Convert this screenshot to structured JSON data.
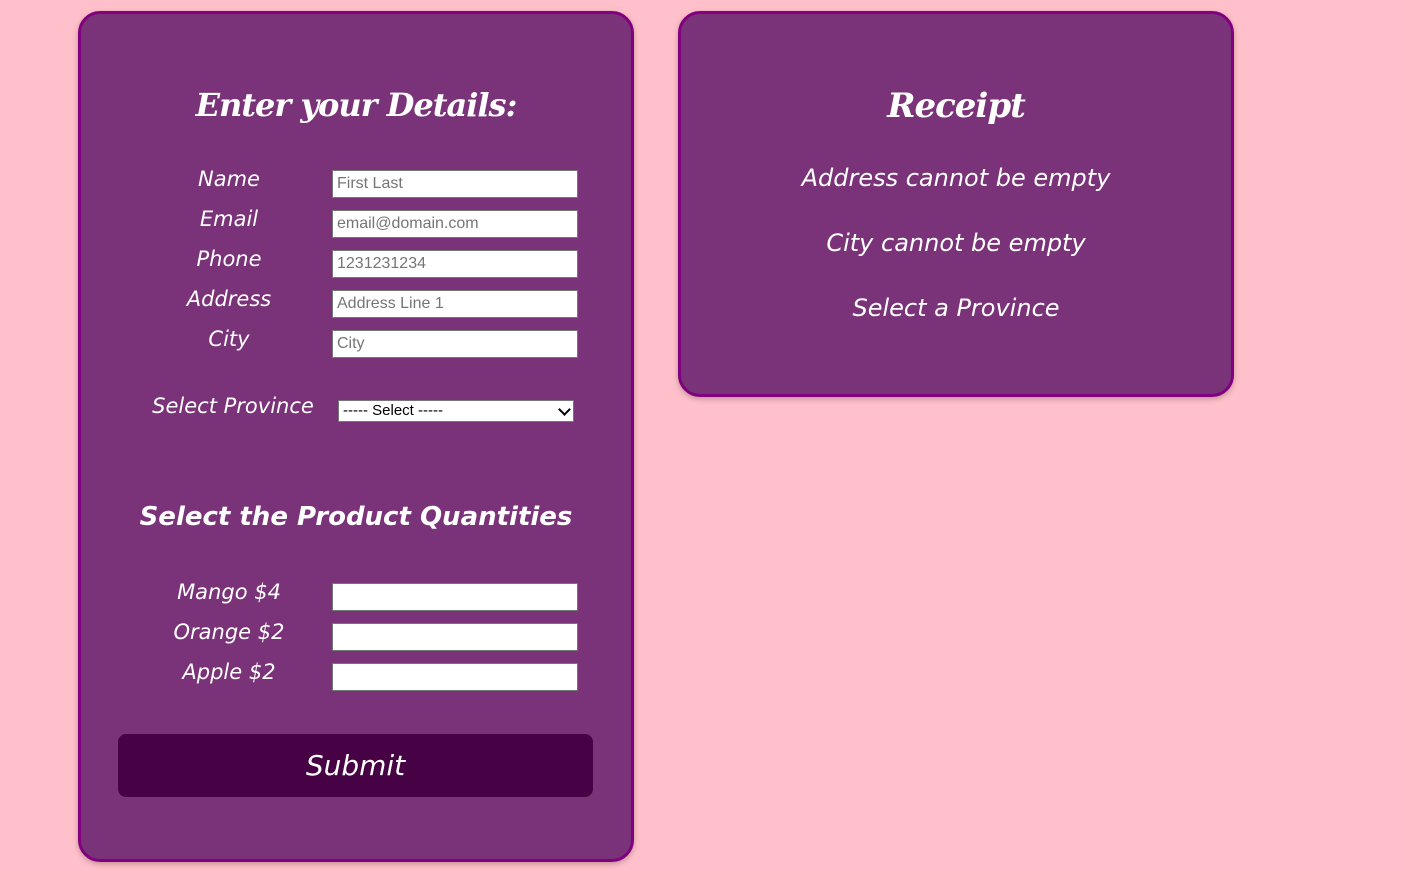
{
  "form": {
    "title": "Enter your Details:",
    "fields": [
      {
        "label": "Name",
        "placeholder": "First Last"
      },
      {
        "label": "Email",
        "placeholder": "email@domain.com"
      },
      {
        "label": "Phone",
        "placeholder": "1231231234"
      },
      {
        "label": "Address",
        "placeholder": "Address Line 1"
      },
      {
        "label": "City",
        "placeholder": "City"
      }
    ],
    "province": {
      "label": "Select Province",
      "selected": "----- Select -----"
    },
    "products_title": "Select the Product Quantities",
    "products": [
      {
        "label": "Mango $4",
        "value": ""
      },
      {
        "label": "Orange $2",
        "value": ""
      },
      {
        "label": "Apple $2",
        "value": ""
      }
    ],
    "submit_label": "Submit"
  },
  "receipt": {
    "title": "Receipt",
    "messages": [
      "Address cannot be empty",
      "City cannot be empty",
      "Select a Province"
    ]
  },
  "colors": {
    "page_background": "#ffc0cb",
    "panel_background": "#7a3378",
    "panel_border": "#800080",
    "submit_background": "#470145",
    "text": "#ffffff"
  }
}
